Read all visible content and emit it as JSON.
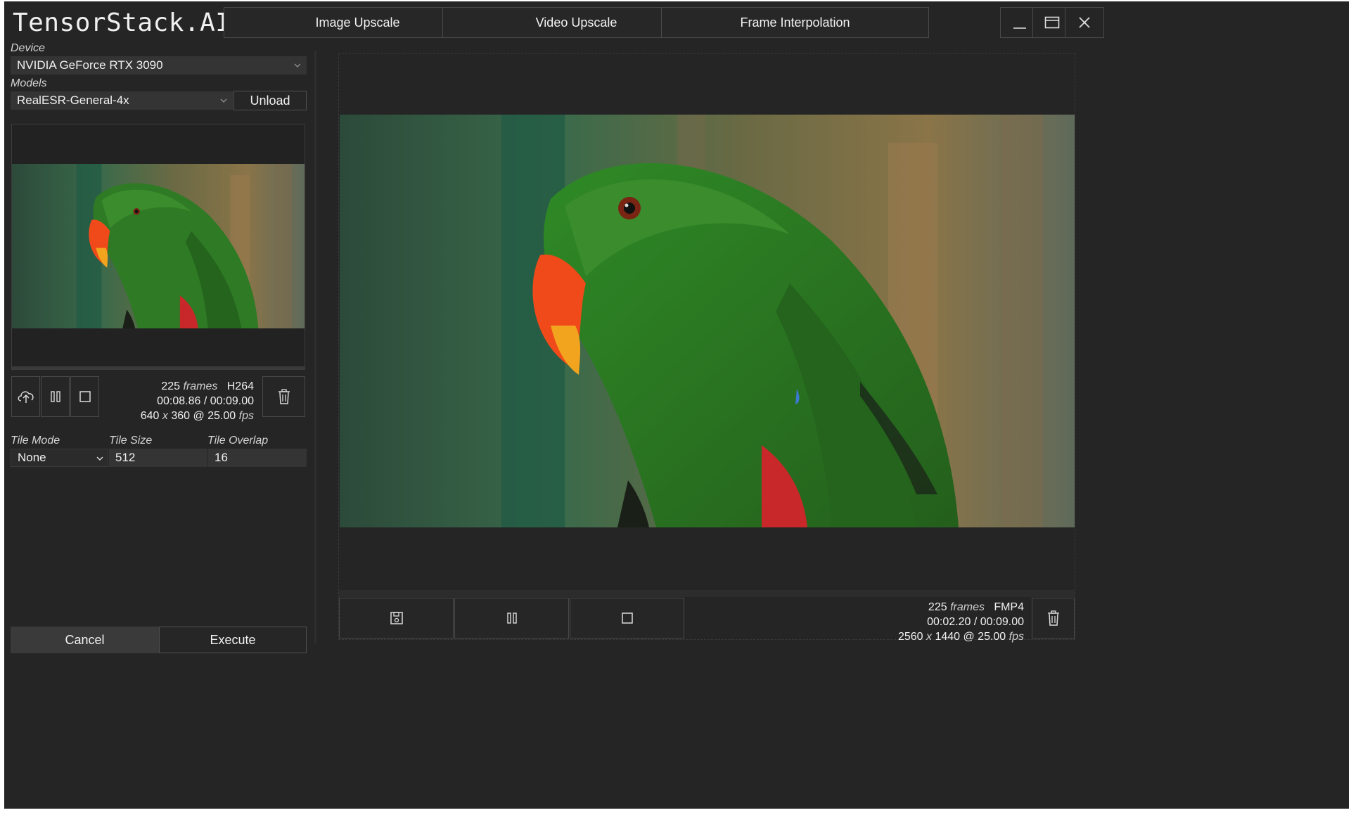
{
  "app": {
    "title": "TensorStack.AI"
  },
  "tabs": [
    "Image Upscale",
    "Video Upscale",
    "Frame Interpolation"
  ],
  "window_controls": [
    "minimize-icon",
    "maximize-icon",
    "close-icon"
  ],
  "sidebar": {
    "device_label": "Device",
    "device_value": "NVIDIA GeForce RTX 3090",
    "models_label": "Models",
    "model_value": "RealESR-General-4x",
    "unload_label": "Unload",
    "input_video": {
      "frames": "225",
      "frames_unit": "frames",
      "codec": "H264",
      "time": "00:08.86 / 00:09.00",
      "res_w": "640",
      "x": "x",
      "res_h": "360 @ 25.00",
      "fps_unit": "fps",
      "icons": [
        "upload-icon",
        "pause-icon",
        "stop-icon",
        "trash-icon"
      ]
    },
    "tile_mode_label": "Tile Mode",
    "tile_size_label": "Tile Size",
    "tile_overlap_label": "Tile Overlap",
    "tile_mode_value": "None",
    "tile_size_value": "512",
    "tile_overlap_value": "16",
    "cancel_label": "Cancel",
    "execute_label": "Execute"
  },
  "output_video": {
    "frames": "225",
    "frames_unit": "frames",
    "codec": "FMP4",
    "time": "00:02.20 / 00:09.00",
    "res_w": "2560",
    "x": "x",
    "res_h": "1440 @ 25.00",
    "fps_unit": "fps",
    "icons": [
      "save-icon",
      "pause-icon",
      "stop-icon",
      "trash-icon"
    ]
  },
  "colors": {
    "background": "#252525",
    "field": "#343434",
    "parrot_green": "#2f7a24",
    "beak": "#f04a1a"
  }
}
